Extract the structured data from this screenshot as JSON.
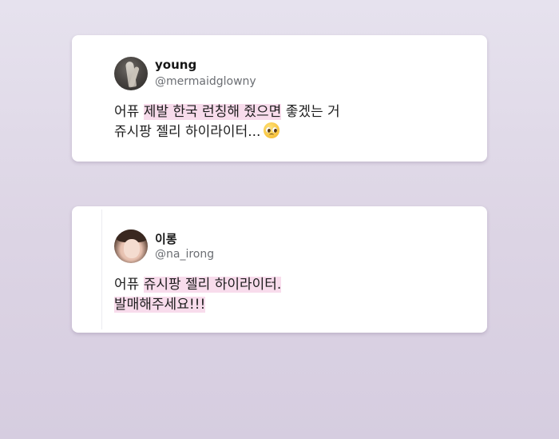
{
  "tweets": [
    {
      "name": "young",
      "handle": "@mermaidglowny",
      "line1_pre": "어퓨 ",
      "line1_highlight": "제발 한국 런칭해 줬으면",
      "line1_post": " 좋겠는 거",
      "line2": "쥬시팡 젤리 하이라이터...",
      "emoji_icon": "pleading-face-icon",
      "avatar_icon": "figure-avatar"
    },
    {
      "name": "이롱",
      "handle": "@na_irong",
      "line1_pre": "어퓨 ",
      "line1_highlight": "쥬시팡 젤리 하이라이터.",
      "line2_highlight": "발매해주세요!!!",
      "avatar_icon": "portrait-avatar"
    }
  ],
  "colors": {
    "highlight": "#f8dcec",
    "card_bg": "#ffffff",
    "background_top": "#e6e2ee",
    "background_bottom": "#d6cde0"
  }
}
